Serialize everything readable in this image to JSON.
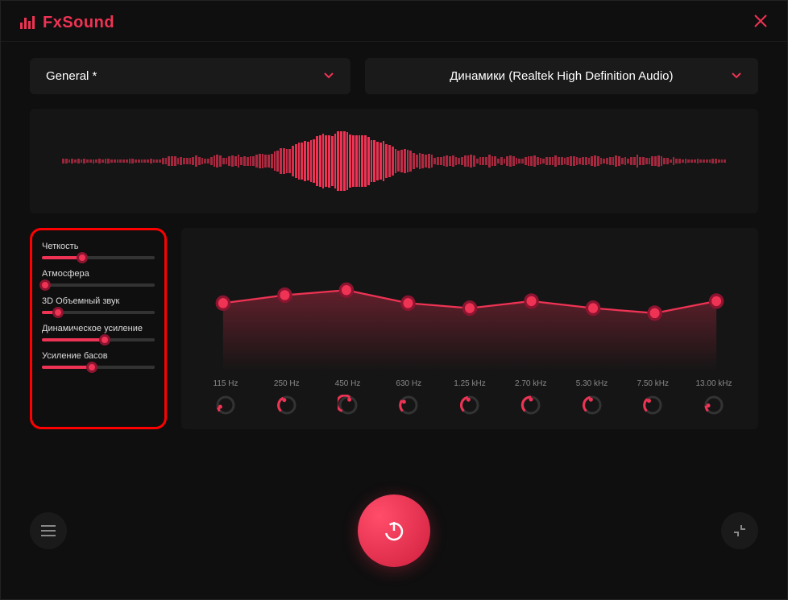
{
  "app": {
    "name": "FxSound"
  },
  "dropdowns": {
    "preset": "General *",
    "output": "Динамики (Realtek High Definition Audio)"
  },
  "sliders": [
    {
      "label": "Четкость",
      "value": 36
    },
    {
      "label": "Атмосфера",
      "value": 3
    },
    {
      "label": "3D Объемный звук",
      "value": 14
    },
    {
      "label": "Динамическое усиление",
      "value": 56
    },
    {
      "label": "Усиление басов",
      "value": 44
    }
  ],
  "eq": {
    "bands": [
      {
        "freq": "115 Hz",
        "value": 0.5,
        "knob": 0.1
      },
      {
        "freq": "250 Hz",
        "value": 0.58,
        "knob": 0.4
      },
      {
        "freq": "450 Hz",
        "value": 0.63,
        "knob": 0.55
      },
      {
        "freq": "630 Hz",
        "value": 0.5,
        "knob": 0.3
      },
      {
        "freq": "1.25 kHz",
        "value": 0.45,
        "knob": 0.45
      },
      {
        "freq": "2.70 kHz",
        "value": 0.52,
        "knob": 0.5
      },
      {
        "freq": "5.30 kHz",
        "value": 0.45,
        "knob": 0.45
      },
      {
        "freq": "7.50 kHz",
        "value": 0.4,
        "knob": 0.35
      },
      {
        "freq": "13.00 kHz",
        "value": 0.52,
        "knob": 0.15
      }
    ]
  },
  "colors": {
    "accent": "#ef3354",
    "bg": "#0f0f0f",
    "panel": "#151515"
  }
}
